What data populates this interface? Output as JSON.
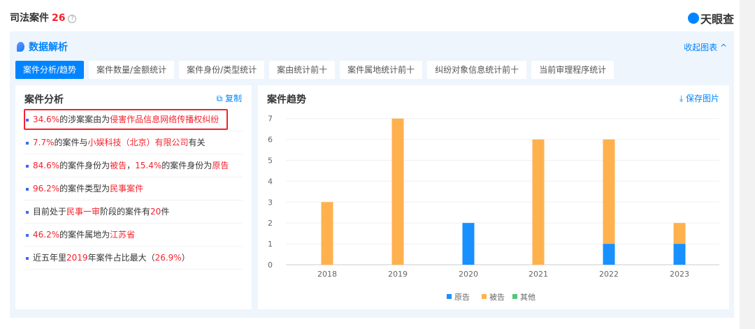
{
  "header": {
    "title": "司法案件",
    "count": "26",
    "help": "?",
    "logo": "天眼查"
  },
  "panel": {
    "title": "数据解析",
    "collapse": "收起图表 ^",
    "tabs": [
      "案件分析/趋势",
      "案件数量/金额统计",
      "案件身份/类型统计",
      "案由统计前十",
      "案件属地统计前十",
      "纠纷对象信息统计前十",
      "当前审理程序统计"
    ]
  },
  "analysis": {
    "title": "案件分析",
    "copy": "复制",
    "items": [
      [
        [
          "34.6%",
          1
        ],
        [
          "的涉案案由为",
          0
        ],
        [
          "侵害作品信息网络传播权纠纷",
          1
        ]
      ],
      [
        [
          "7.7%",
          1
        ],
        [
          "的案件与",
          0
        ],
        [
          "小娱科技（北京）有限公司",
          1
        ],
        [
          "有关",
          0
        ]
      ],
      [
        [
          "84.6%",
          1
        ],
        [
          "的案件身份为",
          0
        ],
        [
          "被告",
          1
        ],
        [
          "，",
          0
        ],
        [
          "15.4%",
          1
        ],
        [
          "的案件身份为",
          0
        ],
        [
          "原告",
          1
        ]
      ],
      [
        [
          "96.2%",
          1
        ],
        [
          "的案件类型为",
          0
        ],
        [
          "民事案件",
          1
        ]
      ],
      [
        [
          "目前处于",
          0
        ],
        [
          "民事一审",
          1
        ],
        [
          "阶段的案件有",
          0
        ],
        [
          "20",
          1
        ],
        [
          "件",
          0
        ]
      ],
      [
        [
          "46.2%",
          1
        ],
        [
          "的案件属地为",
          0
        ],
        [
          "江苏省",
          1
        ]
      ],
      [
        [
          "近五年里",
          0
        ],
        [
          "2019",
          1
        ],
        [
          "年案件占比最大（",
          0
        ],
        [
          "26.9%",
          1
        ],
        [
          "）",
          0
        ]
      ]
    ]
  },
  "trend": {
    "title": "案件趋势",
    "save": "保存图片"
  },
  "chart_data": {
    "type": "bar",
    "stacked": true,
    "categories": [
      "2018",
      "2019",
      "2020",
      "2021",
      "2022",
      "2023"
    ],
    "series": [
      {
        "name": "原告",
        "color": "#1890ff",
        "values": [
          0,
          0,
          2,
          0,
          1,
          1
        ]
      },
      {
        "name": "被告",
        "color": "#ffb14e",
        "values": [
          3,
          7,
          0,
          6,
          5,
          1
        ]
      },
      {
        "name": "其他",
        "color": "#52c77a",
        "values": [
          0,
          0,
          0,
          0,
          0,
          0
        ]
      }
    ],
    "ylim": [
      0,
      7
    ],
    "yticks": [
      0,
      1,
      2,
      3,
      4,
      5,
      6,
      7
    ],
    "legend": "bottom"
  }
}
